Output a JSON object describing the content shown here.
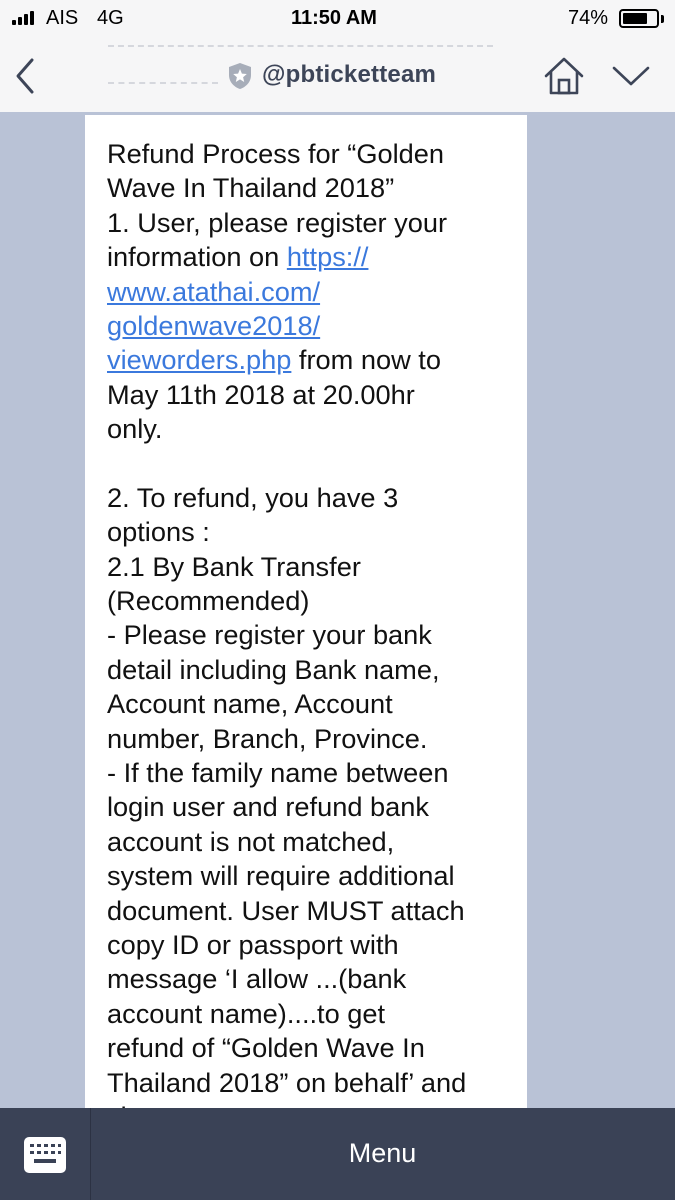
{
  "status_bar": {
    "carrier": "AIS",
    "network": "4G",
    "time": "11:50 AM",
    "battery_percent": "74%",
    "battery_level": 0.74,
    "signal_bars": 4
  },
  "header": {
    "account_name": "@pbticketteam",
    "verified_icon": "shield-star-icon",
    "back_icon": "chevron-left-icon",
    "home_icon": "home-icon",
    "more_icon": "chevron-down-icon"
  },
  "message": {
    "lines": [
      "Refund Process for “Golden",
      "Wave In Thailand 2018”",
      "1. User, please register your",
      "information on ",
      "www.atathai.com/",
      "goldenwave2018/",
      "vieworders.php",
      "May 11th 2018 at 20.00hr",
      "only.",
      "",
      "2. To refund, you have 3",
      "options :",
      "2.1 By Bank Transfer",
      "(Recommended)",
      "- Please register your bank",
      "detail including Bank name,",
      "Account name, Account",
      "number, Branch, Province.",
      "- If the family name between",
      "login user and refund bank",
      "account is not matched,",
      "system will require additional",
      "document. User MUST attach",
      "copy ID or passport with",
      "message ‘I allow ...(bank",
      "account name)....to get",
      "refund of “Golden Wave In",
      "Thailand 2018” on behalf’ and",
      "sign your name"
    ],
    "link_part1": "https://",
    "link_after": " from now to"
  },
  "bottom_bar": {
    "keyboard_icon": "keyboard-icon",
    "menu_label": "Menu"
  },
  "colors": {
    "background": "#b9c2d6",
    "bar": "#f6f6f7",
    "bottom_bar": "#3a4256",
    "link": "#3b79dd"
  }
}
